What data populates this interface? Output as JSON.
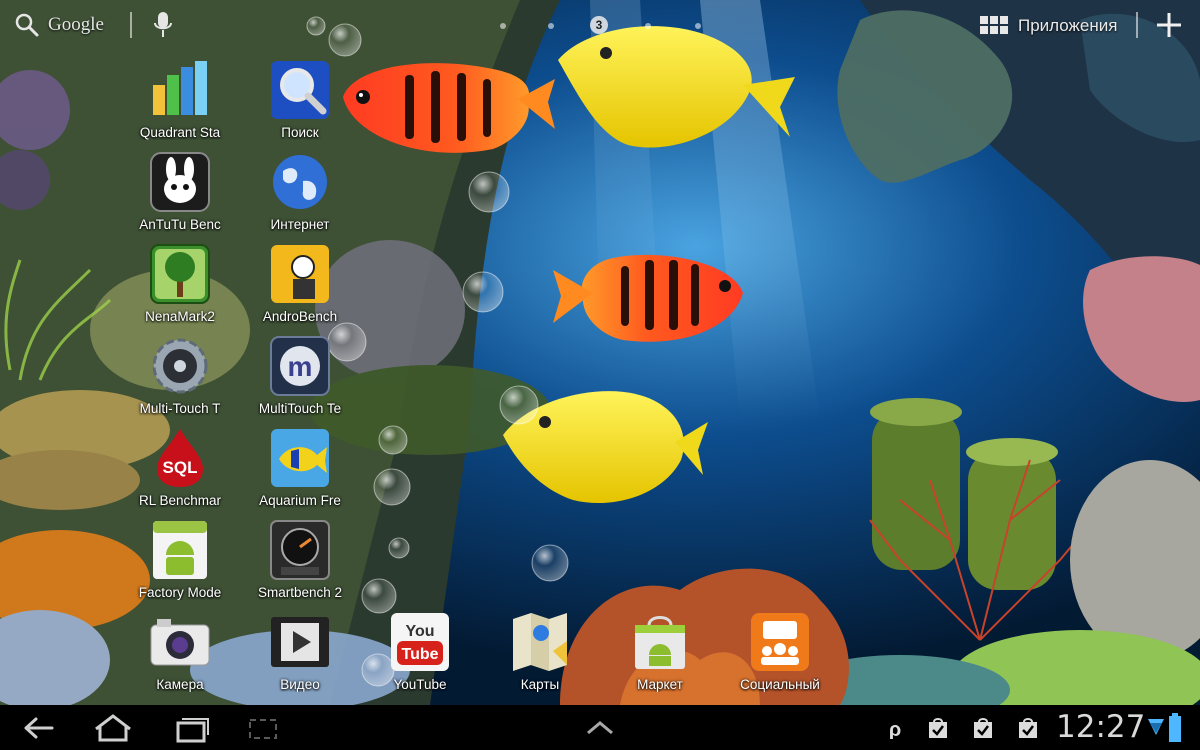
{
  "top_bar": {
    "search_label": "Google",
    "current_page": "3",
    "apps_label": "Приложения"
  },
  "shortcuts": [
    {
      "label": "Quadrant Sta",
      "icon": "quadrant-bar-chart-icon"
    },
    {
      "label": "Поиск",
      "icon": "magnifier-search-icon"
    },
    {
      "label": "AnTuTu Benc",
      "icon": "antutu-rabbit-icon"
    },
    {
      "label": "Интернет",
      "icon": "globe-icon"
    },
    {
      "label": "NenaMark2",
      "icon": "nenamark-tree-icon"
    },
    {
      "label": "AndroBench",
      "icon": "androbench-icon"
    },
    {
      "label": "Multi-Touch T",
      "icon": "gear-icon"
    },
    {
      "label": "MultiTouch Te",
      "icon": "multitouch-m-icon"
    },
    {
      "label": "RL Benchmar",
      "icon": "sql-drop-icon"
    },
    {
      "label": "Aquarium Fre",
      "icon": "fish-icon"
    },
    {
      "label": "Factory Mode",
      "icon": "android-robot-icon"
    },
    {
      "label": "Smartbench 2",
      "icon": "speedometer-icon"
    }
  ],
  "dock": [
    {
      "label": "Камера",
      "icon": "camera-icon"
    },
    {
      "label": "Видео",
      "icon": "video-film-icon"
    },
    {
      "label": "YouTube",
      "icon": "youtube-icon"
    },
    {
      "label": "Карты",
      "icon": "maps-icon"
    },
    {
      "label": "Маркет",
      "icon": "market-bag-icon"
    },
    {
      "label": "Социальный",
      "icon": "social-hub-icon"
    }
  ],
  "system_bar": {
    "clock": "12:27",
    "nav": [
      "back-icon",
      "home-icon",
      "recent-apps-icon",
      "screenshot-icon",
      "chevron-up-icon"
    ],
    "notifications": [
      "p-icon",
      "market-update-icon",
      "market-update-icon",
      "market-update-icon"
    ],
    "accent": "#4fb7ff"
  },
  "theme": {
    "fish_red": "#e83a1c",
    "fish_yellow": "#f5e21a",
    "water": "#0a3d78"
  }
}
